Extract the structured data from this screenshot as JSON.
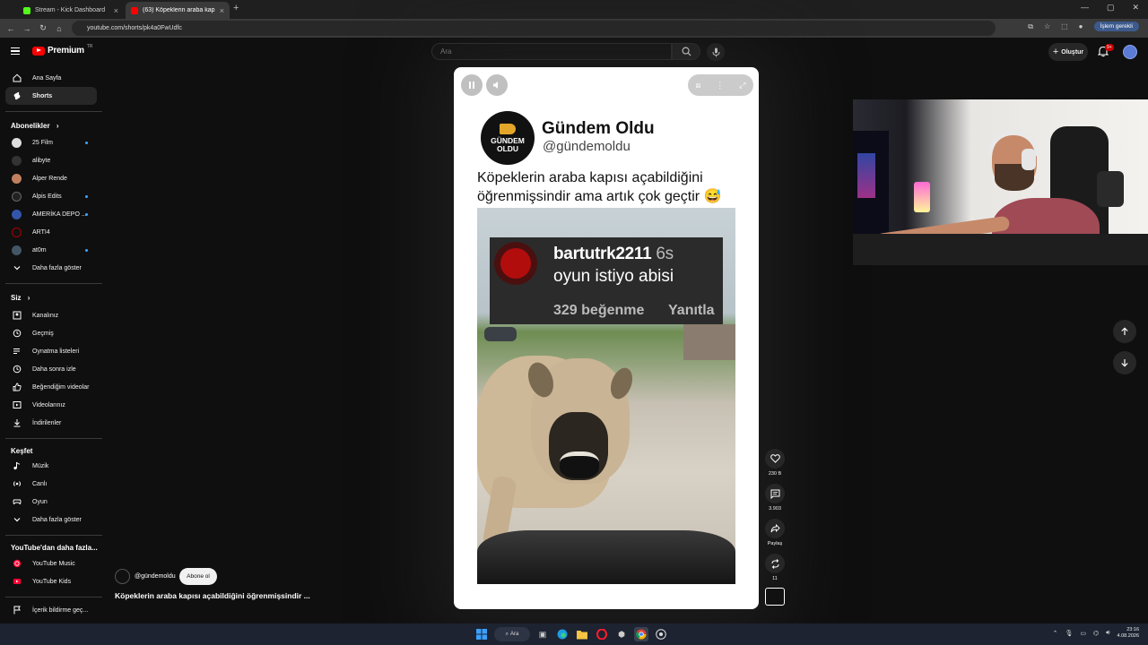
{
  "browser": {
    "tabs": [
      {
        "label": "Stream - Kick Dashboard",
        "icon": "kick-icon",
        "color": "#53fc18"
      },
      {
        "label": "(63) Köpeklerin araba kapısı...",
        "icon": "youtube-icon",
        "color": "#ff0000"
      }
    ],
    "url": "youtube.com/shorts/pk4a0FwUdfc",
    "update_label": "İşlem gerekli"
  },
  "youtube": {
    "logo_label": "Premium",
    "logo_region": "TR",
    "search_placeholder": "Ara",
    "create_label": "Oluştur",
    "notif_count": "9+"
  },
  "sidebar": {
    "main": [
      {
        "label": "Ana Sayfa",
        "icon": "home-icon"
      },
      {
        "label": "Shorts",
        "icon": "shorts-icon",
        "active": true
      }
    ],
    "subs_title": "Abonelikler",
    "subs": [
      {
        "label": "25 Film",
        "color": "#dddddd",
        "dot": true
      },
      {
        "label": "alibyte",
        "color": "#333333",
        "dot": false
      },
      {
        "label": "Alper Rende",
        "color": "#c08060",
        "dot": false
      },
      {
        "label": "Alpis Edits",
        "color": "#222222",
        "dot": true
      },
      {
        "label": "AMERİKA DEPO ...",
        "color": "#3355aa",
        "dot": true
      },
      {
        "label": "ARTI4",
        "color": "#111111",
        "dot": false
      },
      {
        "label": "at0m",
        "color": "#445566",
        "dot": true
      }
    ],
    "subs_more": "Daha fazla göster",
    "you_title": "Siz",
    "you": [
      {
        "label": "Kanalınız",
        "icon": "channel-icon"
      },
      {
        "label": "Geçmiş",
        "icon": "history-icon"
      },
      {
        "label": "Oynatma listeleri",
        "icon": "playlist-icon"
      },
      {
        "label": "Daha sonra izle",
        "icon": "clock-icon"
      },
      {
        "label": "Beğendiğim videolar",
        "icon": "like-icon"
      },
      {
        "label": "Videolarınız",
        "icon": "video-icon"
      },
      {
        "label": "İndirilenler",
        "icon": "download-icon"
      }
    ],
    "explore_title": "Keşfet",
    "explore": [
      {
        "label": "Müzik",
        "icon": "music-icon"
      },
      {
        "label": "Canlı",
        "icon": "live-icon"
      },
      {
        "label": "Oyun",
        "icon": "gaming-icon"
      }
    ],
    "explore_more": "Daha fazla göster",
    "more_title": "YouTube'dan daha fazla...",
    "more": [
      {
        "label": "YouTube Music",
        "icon": "youtube-music-icon"
      },
      {
        "label": "YouTube Kids",
        "icon": "youtube-kids-icon"
      }
    ],
    "report_label": "İçerik bildirme geç..."
  },
  "short": {
    "logo_line1": "GÜNDEM",
    "logo_line2": "OLDU",
    "account_name": "Gündem Oldu",
    "account_handle": "@gündemoldu",
    "caption": "Köpeklerin araba kapısı açabildiğini öğrenmişsindir ama artık çok geçtir 😅",
    "comment": {
      "user": "bartutrk2211",
      "time": "6s",
      "text": "oyun istiyo abisi",
      "likes": "329 beğenme",
      "reply": "Yanıtla"
    }
  },
  "actions": {
    "likes": "230 B",
    "comments": "3.903",
    "share": "Paylaş",
    "remix": "11"
  },
  "channel": {
    "handle": "@gündemoldu",
    "subscribe": "Abone ol",
    "title": "Köpeklerin araba kapısı açabildiğini öğrenmişsindir ..."
  },
  "taskbar": {
    "search_label": "Ara",
    "time": "23:16",
    "date": "4.08.2026"
  }
}
